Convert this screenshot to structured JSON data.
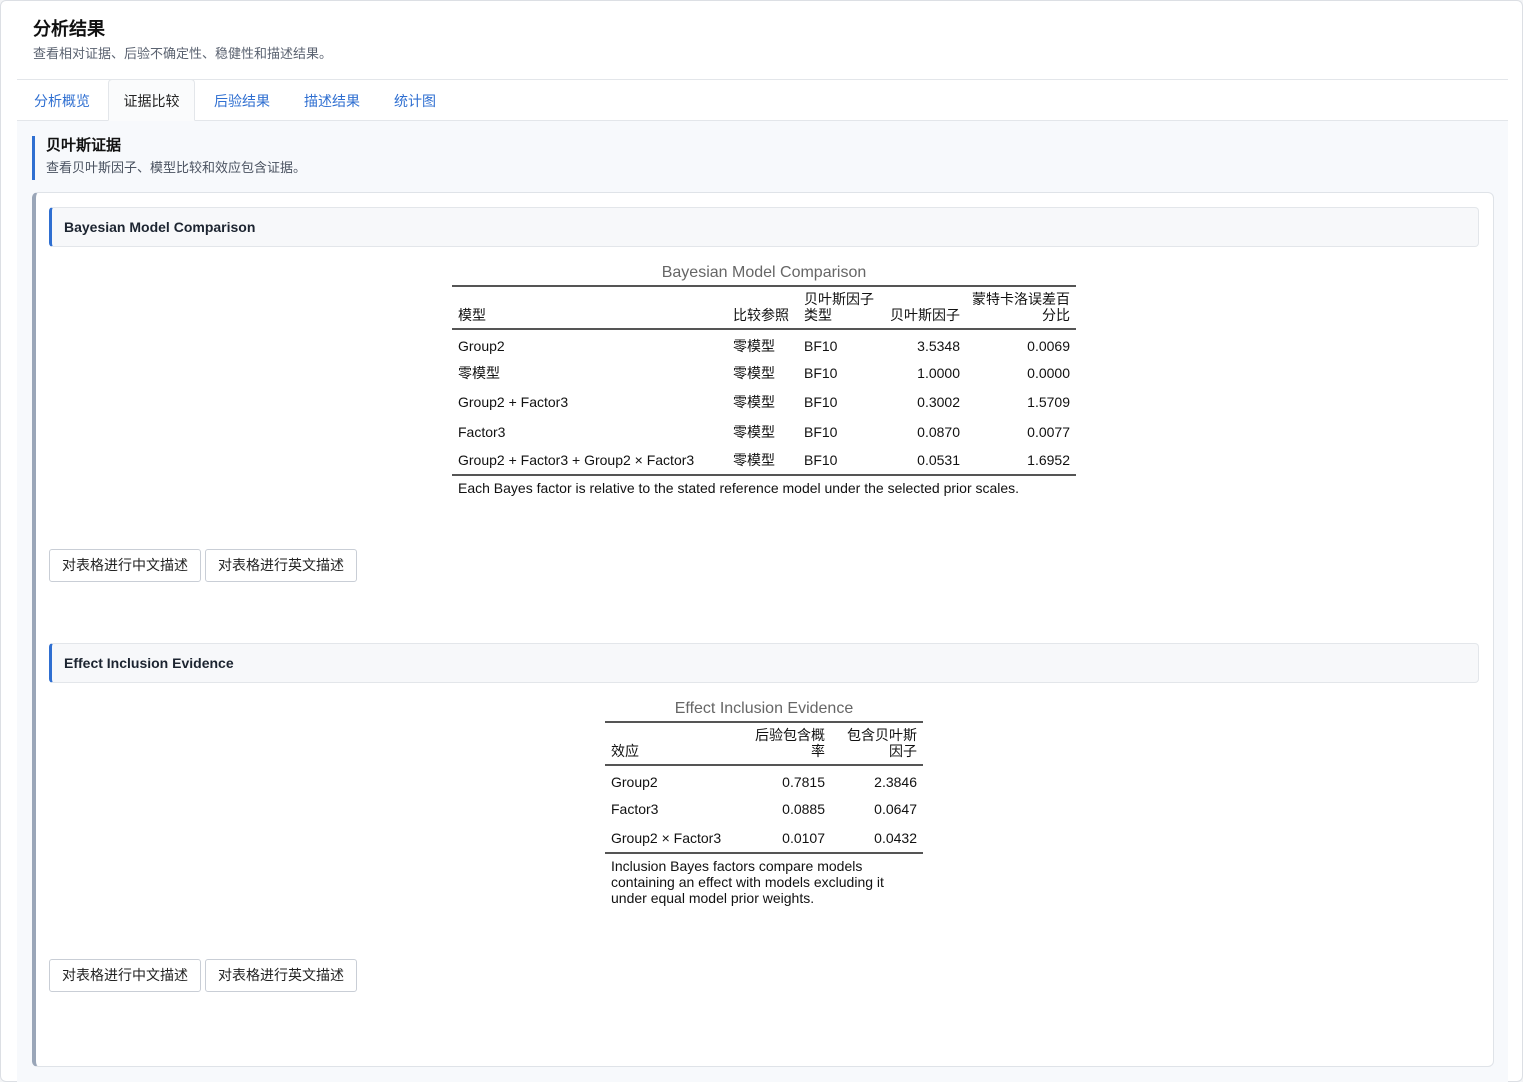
{
  "header": {
    "title": "分析结果",
    "subtitle": "查看相对证据、后验不确定性、稳健性和描述结果。"
  },
  "tabs": [
    {
      "label": "分析概览"
    },
    {
      "label": "证据比较"
    },
    {
      "label": "后验结果"
    },
    {
      "label": "描述结果"
    },
    {
      "label": "统计图"
    }
  ],
  "section": {
    "title": "贝叶斯证据",
    "subtitle": "查看贝叶斯因子、模型比较和效应包含证据。"
  },
  "model_comparison": {
    "panel_title": "Bayesian Model Comparison",
    "caption": "Bayesian Model Comparison",
    "columns": [
      "模型",
      "比较参照",
      "贝叶斯因子类型",
      "贝叶斯因子",
      "蒙特卡洛误差百分比"
    ],
    "rows": [
      {
        "model": "Group2",
        "ref": "零模型",
        "type": "BF10",
        "bf": "3.5348",
        "err": "0.0069"
      },
      {
        "model": "零模型",
        "ref": "零模型",
        "type": "BF10",
        "bf": "1.0000",
        "err": "0.0000"
      },
      {
        "model": "Group2 + Factor3",
        "ref": "零模型",
        "type": "BF10",
        "bf": "0.3002",
        "err": "1.5709"
      },
      {
        "model": "Factor3",
        "ref": "零模型",
        "type": "BF10",
        "bf": "0.0870",
        "err": "0.0077"
      },
      {
        "model": "Group2 + Factor3 + Group2 × Factor3",
        "ref": "零模型",
        "type": "BF10",
        "bf": "0.0531",
        "err": "1.6952"
      }
    ],
    "note": "Each Bayes factor is relative to the stated reference model under the selected prior scales.",
    "btn_zh": "对表格进行中文描述",
    "btn_en": "对表格进行英文描述"
  },
  "inclusion": {
    "panel_title": "Effect Inclusion Evidence",
    "caption": "Effect Inclusion Evidence",
    "columns": [
      "效应",
      "后验包含概率",
      "包含贝叶斯因子"
    ],
    "rows": [
      {
        "effect": "Group2",
        "prob": "0.7815",
        "bf": "2.3846"
      },
      {
        "effect": "Factor3",
        "prob": "0.0885",
        "bf": "0.0647"
      },
      {
        "effect": "Group2 × Factor3",
        "prob": "0.0107",
        "bf": "0.0432"
      }
    ],
    "note": "Inclusion Bayes factors compare models containing an effect with models excluding it under equal model prior weights.",
    "btn_zh": "对表格进行中文描述",
    "btn_en": "对表格进行英文描述"
  }
}
